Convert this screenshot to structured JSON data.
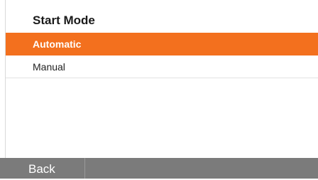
{
  "menu": {
    "title": "Start Mode",
    "options": [
      {
        "label": "Automatic",
        "selected": true
      },
      {
        "label": "Manual",
        "selected": false
      }
    ]
  },
  "footer": {
    "back_label": "Back"
  },
  "colors": {
    "highlight": "#f3701e",
    "footer_bar": "#7b7b7b"
  }
}
